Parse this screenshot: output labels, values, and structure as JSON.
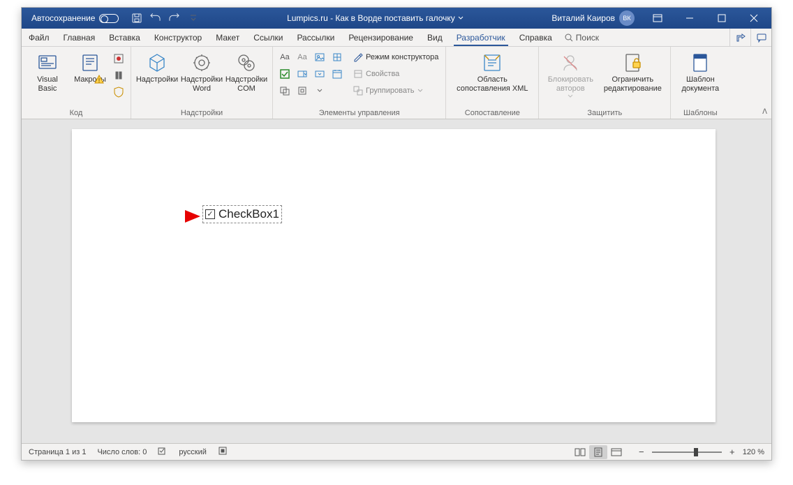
{
  "title": "Lumpics.ru - Как в Ворде поставить галочку",
  "autosave": "Автосохранение",
  "user": {
    "name": "Виталий Каиров",
    "initials": "ВК"
  },
  "tabs": {
    "file": "Файл",
    "home": "Главная",
    "insert": "Вставка",
    "design": "Конструктор",
    "layout": "Макет",
    "references": "Ссылки",
    "mailings": "Рассылки",
    "review": "Рецензирование",
    "view": "Вид",
    "developer": "Разработчик",
    "help": "Справка",
    "search": "Поиск"
  },
  "ribbon": {
    "code": {
      "label": "Код",
      "visual_basic": "Visual\nBasic",
      "macros": "Макросы"
    },
    "addins": {
      "label": "Надстройки",
      "addins": "Надстройки",
      "word_addins": "Надстройки\nWord",
      "com_addins": "Надстройки\nCOM"
    },
    "controls": {
      "label": "Элементы управления",
      "design_mode": "Режим конструктора",
      "properties": "Свойства",
      "group": "Группировать"
    },
    "mapping": {
      "label": "Сопоставление",
      "xml_pane": "Область\nсопоставления XML"
    },
    "protect": {
      "label": "Защитить",
      "block_authors": "Блокировать\nавторов",
      "restrict": "Ограничить\nредактирование"
    },
    "templates": {
      "label": "Шаблоны",
      "doc_template": "Шаблон\nдокумента"
    }
  },
  "document": {
    "checkbox_label": "CheckBox1"
  },
  "status": {
    "page": "Страница 1 из 1",
    "words": "Число слов: 0",
    "lang": "русский",
    "zoom": "120 %"
  }
}
